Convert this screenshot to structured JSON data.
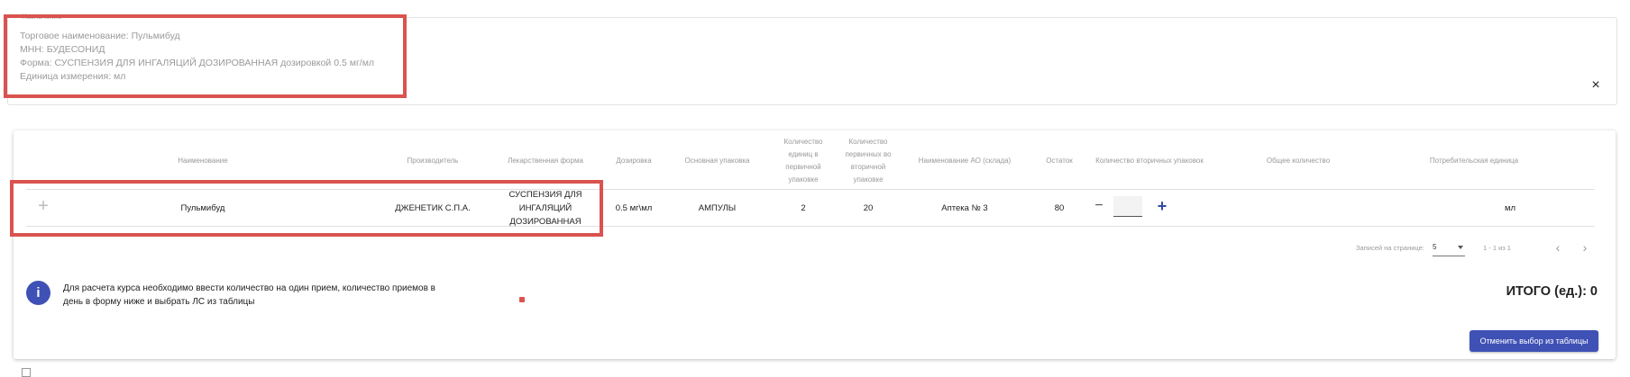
{
  "info": {
    "legend": "Назначение",
    "trade_name": "Торговое наименование: Пульмибуд",
    "inn": "МНН: БУДЕСОНИД",
    "form": "Форма: СУСПЕНЗИЯ ДЛЯ ИНГАЛЯЦИЙ ДОЗИРОВАННАЯ дозировкой 0.5 мг/мл",
    "unit": "Единица измерения: мл",
    "close_icon": "×"
  },
  "table": {
    "headers": {
      "name": "Наименование",
      "manufacturer": "Производитель",
      "dosage_form": "Лекарственная форма",
      "dosage": "Дозировка",
      "main_pack": "Основная упаковка",
      "units_in_primary": "Количество единиц в первичной упаковке",
      "primary_in_secondary": "Количество первичных во вторичной упаковке",
      "pharmacy": "Наименование АО (склада)",
      "stock": "Остаток",
      "secondary_count": "Количество вторичных упаковок",
      "total_count": "Общее количество",
      "consumer_unit": "Потребительская единица"
    },
    "row": {
      "expand_icon": "+",
      "name": "Пульмибуд",
      "manufacturer": "ДЖЕНЕТИК С.П.А.",
      "dosage_form": "СУСПЕНЗИЯ ДЛЯ ИНГАЛЯЦИЙ ДОЗИРОВАННАЯ",
      "dosage": "0.5 мг\\мл",
      "main_pack": "АМПУЛЫ",
      "units_in_primary": "2",
      "primary_in_secondary": "20",
      "pharmacy": "Аптека № 3",
      "stock": "80",
      "minus_icon": "−",
      "qty_value": "",
      "plus_icon": "+",
      "total_count": "",
      "consumer_unit": "мл"
    }
  },
  "pagination": {
    "rows_per_page_label": "Записей на странице:",
    "rows_per_page_value": "5",
    "range": "1 - 1 из 1",
    "prev_icon": "‹",
    "next_icon": "›"
  },
  "notice": {
    "icon": "i",
    "text": "Для расчета курса необходимо ввести количество на один прием, количество приемов в день в форму ниже и выбрать ЛС из таблицы"
  },
  "total": {
    "label": "ИТОГО (ед.): 0"
  },
  "actions": {
    "cancel_selection": "Отменить выбор из таблицы"
  },
  "colors": {
    "accent": "#3f51b5",
    "highlight": "#d9534f"
  }
}
